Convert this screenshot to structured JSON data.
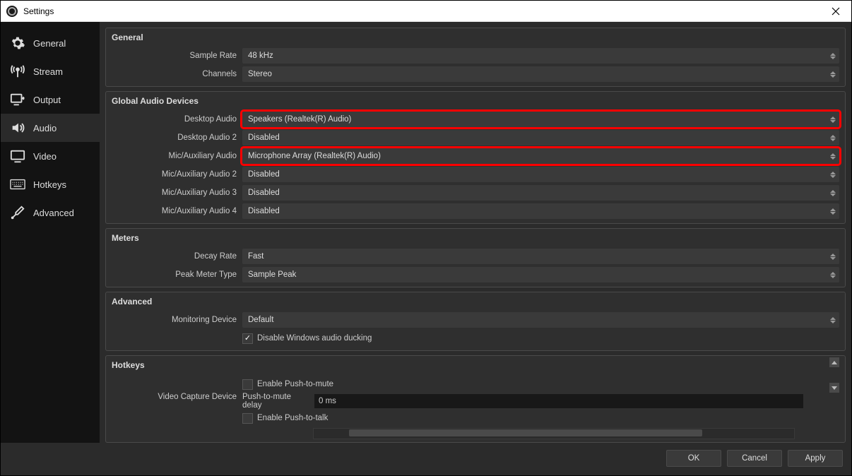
{
  "window": {
    "title": "Settings"
  },
  "sidebar": {
    "items": [
      {
        "label": "General"
      },
      {
        "label": "Stream"
      },
      {
        "label": "Output"
      },
      {
        "label": "Audio"
      },
      {
        "label": "Video"
      },
      {
        "label": "Hotkeys"
      },
      {
        "label": "Advanced"
      }
    ]
  },
  "sections": {
    "general": {
      "title": "General",
      "sample_rate_label": "Sample Rate",
      "sample_rate_value": "48 kHz",
      "channels_label": "Channels",
      "channels_value": "Stereo"
    },
    "devices": {
      "title": "Global Audio Devices",
      "desktop_audio_label": "Desktop Audio",
      "desktop_audio_value": "Speakers (Realtek(R) Audio)",
      "desktop_audio2_label": "Desktop Audio 2",
      "desktop_audio2_value": "Disabled",
      "mic_aux_label": "Mic/Auxiliary Audio",
      "mic_aux_value": "Microphone Array (Realtek(R) Audio)",
      "mic_aux2_label": "Mic/Auxiliary Audio 2",
      "mic_aux2_value": "Disabled",
      "mic_aux3_label": "Mic/Auxiliary Audio 3",
      "mic_aux3_value": "Disabled",
      "mic_aux4_label": "Mic/Auxiliary Audio 4",
      "mic_aux4_value": "Disabled"
    },
    "meters": {
      "title": "Meters",
      "decay_label": "Decay Rate",
      "decay_value": "Fast",
      "peak_label": "Peak Meter Type",
      "peak_value": "Sample Peak"
    },
    "advanced": {
      "title": "Advanced",
      "monitoring_label": "Monitoring Device",
      "monitoring_value": "Default",
      "ducking_text": "Disable Windows audio ducking"
    },
    "hotkeys": {
      "title": "Hotkeys",
      "device_label": "Video Capture Device",
      "push_mute_text": "Enable Push-to-mute",
      "push_mute_delay_label": "Push-to-mute delay",
      "push_mute_delay_value": "0 ms",
      "push_talk_text": "Enable Push-to-talk"
    }
  },
  "footer": {
    "ok": "OK",
    "cancel": "Cancel",
    "apply": "Apply"
  }
}
